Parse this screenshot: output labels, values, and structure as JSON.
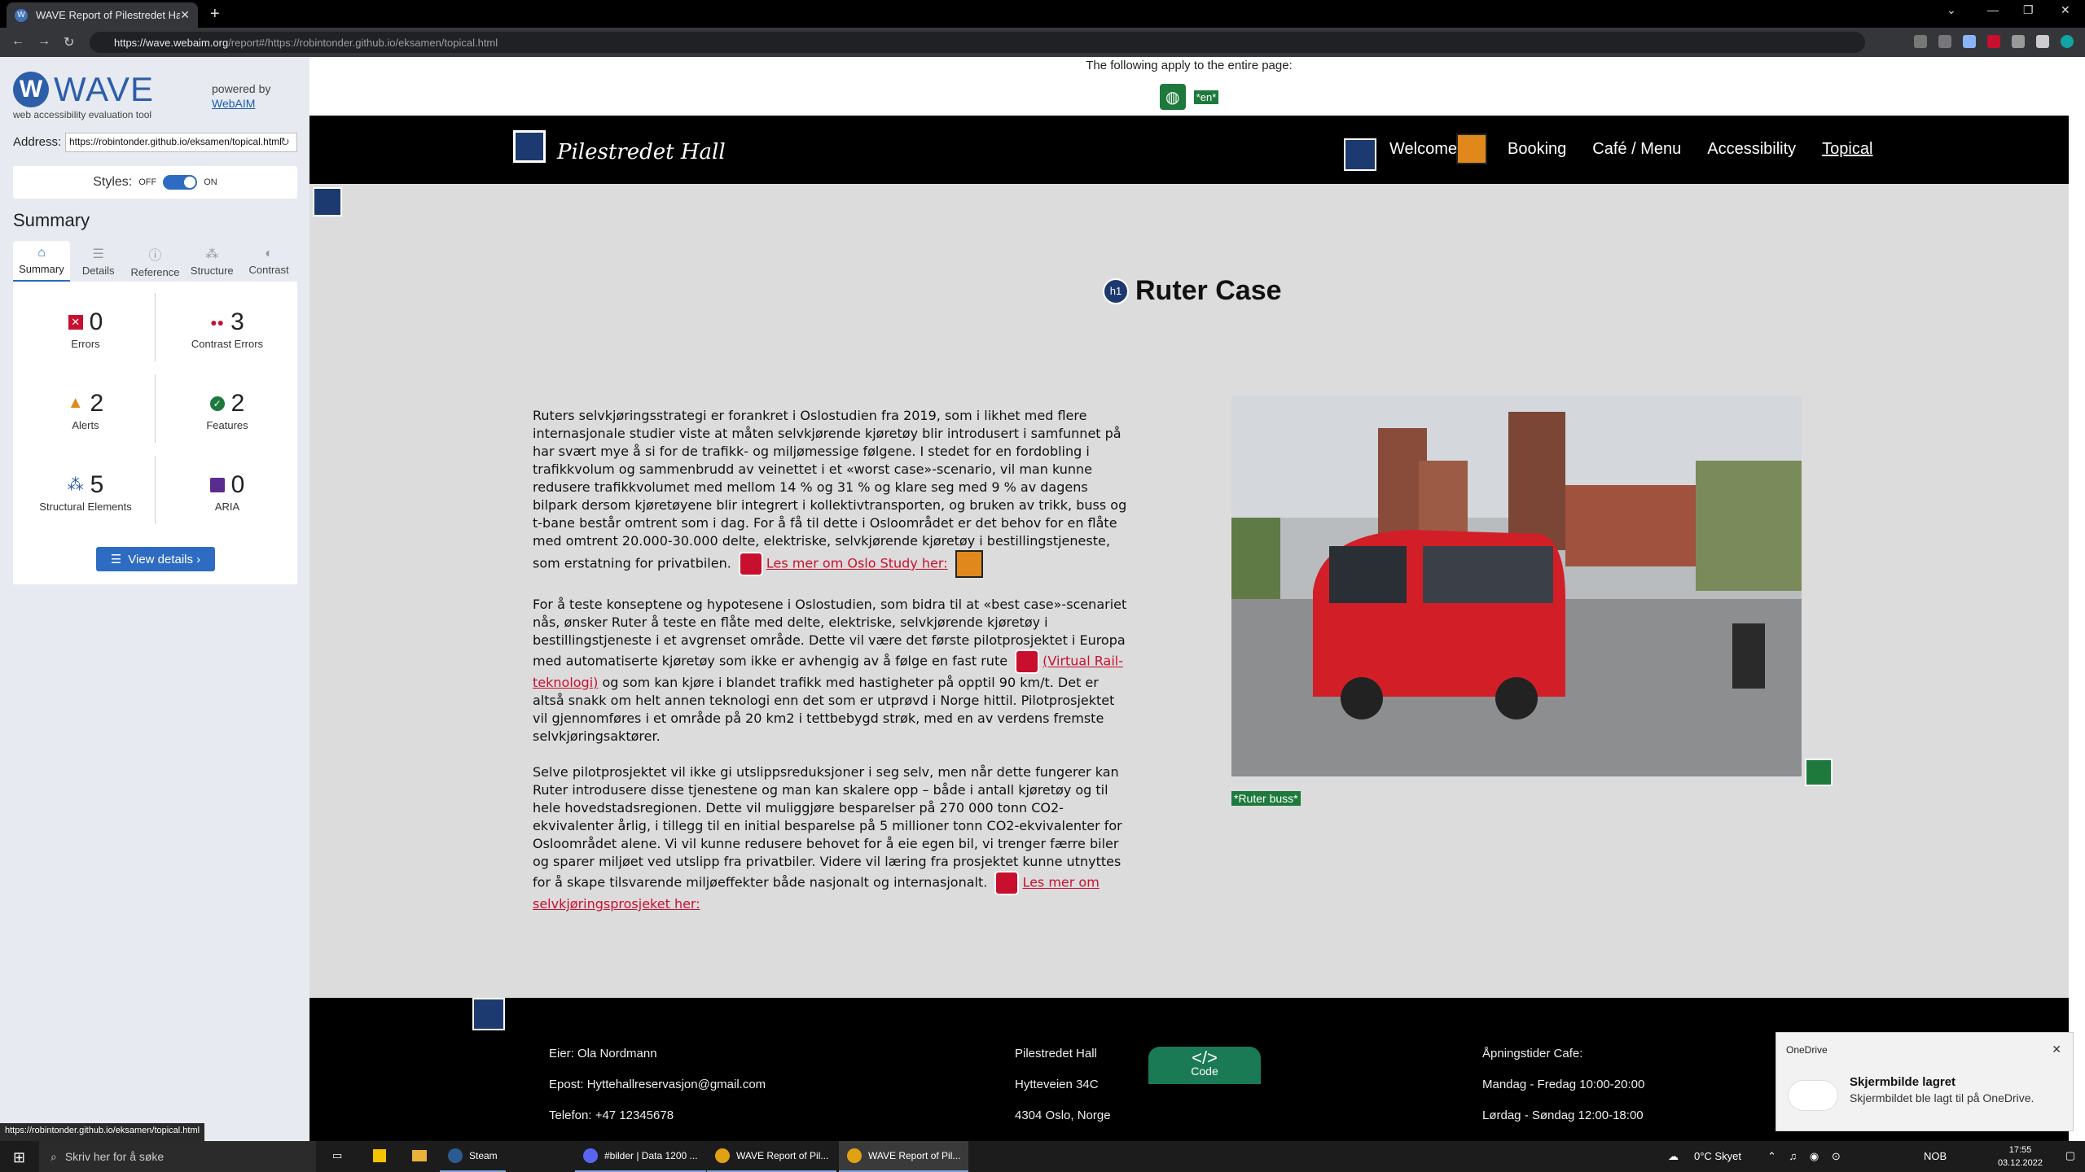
{
  "browser": {
    "tab_title": "WAVE Report of Pilestredet Hall",
    "url_host": "https://wave.webaim.org",
    "url_path": "/report#/https://robintonder.github.io/eksamen/topical.html",
    "status_url": "https://robintonder.github.io/eksamen/topical.html"
  },
  "wave": {
    "logo": "WAVE",
    "subtitle": "web accessibility evaluation tool",
    "powered_by": "powered by",
    "powered_link": "WebAIM",
    "address_label": "Address:",
    "address_value": "https://robintonder.github.io/eksamen/topical.html",
    "styles_label": "Styles:",
    "styles_off": "OFF",
    "styles_on": "ON",
    "summary_title": "Summary",
    "tabs": [
      "Summary",
      "Details",
      "Reference",
      "Structure",
      "Contrast"
    ],
    "stats": {
      "errors": {
        "count": "0",
        "label": "Errors"
      },
      "contrast": {
        "count": "3",
        "label": "Contrast Errors"
      },
      "alerts": {
        "count": "2",
        "label": "Alerts"
      },
      "features": {
        "count": "2",
        "label": "Features"
      },
      "structural": {
        "count": "5",
        "label": "Structural Elements"
      },
      "aria": {
        "count": "0",
        "label": "ARIA"
      }
    },
    "view_details": "View details ›"
  },
  "page": {
    "applies_text": "The following apply to the entire page:",
    "lang_tag": "*en*",
    "site_name": "Pilestredet Hall",
    "nav": [
      "Welcome",
      "Booking",
      "Café / Menu",
      "Accessibility",
      "Topical"
    ],
    "heading_badge": "h1",
    "heading": "Ruter Case",
    "p1": "Ruters selvkjøringsstrategi er forankret i Oslostudien fra 2019, som i likhet med flere internasjonale studier viste at måten selvkjørende kjøretøy blir introdusert i samfunnet på har svært mye å si for de trafikk- og miljømessige følgene. I stedet for en fordobling i trafikkvolum og sammenbrudd av veinettet i et «worst case»-scenario, vil man kunne redusere trafikkvolumet med mellom 14 % og 31 % og klare seg med 9 % av dagens bilpark dersom kjøretøyene blir integrert i kollektivtransporten, og bruken av trikk, buss og t-bane består omtrent som i dag. For å få til dette i Osloområdet er det behov for en flåte med omtrent 20.000-30.000 delte, elektriske, selvkjørende kjøretøy i bestillingstjeneste, som erstatning for privatbilen.",
    "p1_link": "Les mer om Oslo Study her:",
    "p2a": "For å teste konseptene og hypotesene i Oslostudien, som bidra til at «best case»-scenariet nås, ønsker Ruter å teste en flåte med delte, elektriske, selvkjørende kjøretøy i bestillingstjeneste i et avgrenset område. Dette vil være det første pilotprosjektet i Europa med automatiserte kjøretøy som ikke er avhengig av å følge en fast rute",
    "p2_link": "(Virtual Rail-teknologi)",
    "p2b": "og som kan kjøre i blandet trafikk med hastigheter på opptil 90 km/t. Det er altså snakk om helt annen teknologi enn det som er utprøvd i Norge hittil. Pilotprosjektet vil gjennomføres i et område på 20 km2 i tettbebygd strøk, med en av verdens fremste selvkjøringsaktører.",
    "p3": "Selve pilotprosjektet vil ikke gi utslippsreduksjoner i seg selv, men når dette fungerer kan Ruter introdusere disse tjenestene og man kan skalere opp – både i antall kjøretøy og til hele hovedstadsregionen. Dette vil muliggjøre besparelser på 270 000 tonn CO2-ekvivalenter årlig, i tillegg til en initial besparelse på 5 millioner tonn CO2-ekvivalenter for Osloområdet alene. Vi vil kunne redusere behovet for å eie egen bil, vi trenger færre biler og sparer miljøet ved utslipp fra privatbiler. Videre vil læring fra prosjektet kunne utnyttes for å skape tilsvarende miljøeffekter både nasjonalt og internasjonalt.",
    "p3_link": "Les mer om selvkjøringsprosjeket her:",
    "image_alt_tag": "*Ruter buss*",
    "footer": {
      "owner": "Eier: Ola Nordmann",
      "email": "Epost: Hyttehallreservasjon@gmail.com",
      "phone": "Telefon: +47 12345678",
      "venue": "Pilestredet Hall",
      "street": "Hytteveien 34C",
      "city": "4304 Oslo, Norge",
      "hours_title": "Åpningstider Cafe:",
      "hours_weekday": "Mandag - Fredag 10:00-20:00",
      "hours_weekend": "Lørdag - Søndag 12:00-18:00"
    },
    "code_button": "Code",
    "code_symbol": "</>"
  },
  "toast": {
    "app": "OneDrive",
    "title": "Skjermbilde lagret",
    "body": "Skjermbildet ble lagt til på OneDrive."
  },
  "taskbar": {
    "search_placeholder": "Skriv her for å søke",
    "apps": [
      "Steam",
      "#bilder | Data 1200 ...",
      "WAVE Report of Pil...",
      "WAVE Report of Pil..."
    ],
    "weather": "0°C  Skyet",
    "lang": "NOB",
    "time": "17:55",
    "date": "03.12.2022"
  }
}
